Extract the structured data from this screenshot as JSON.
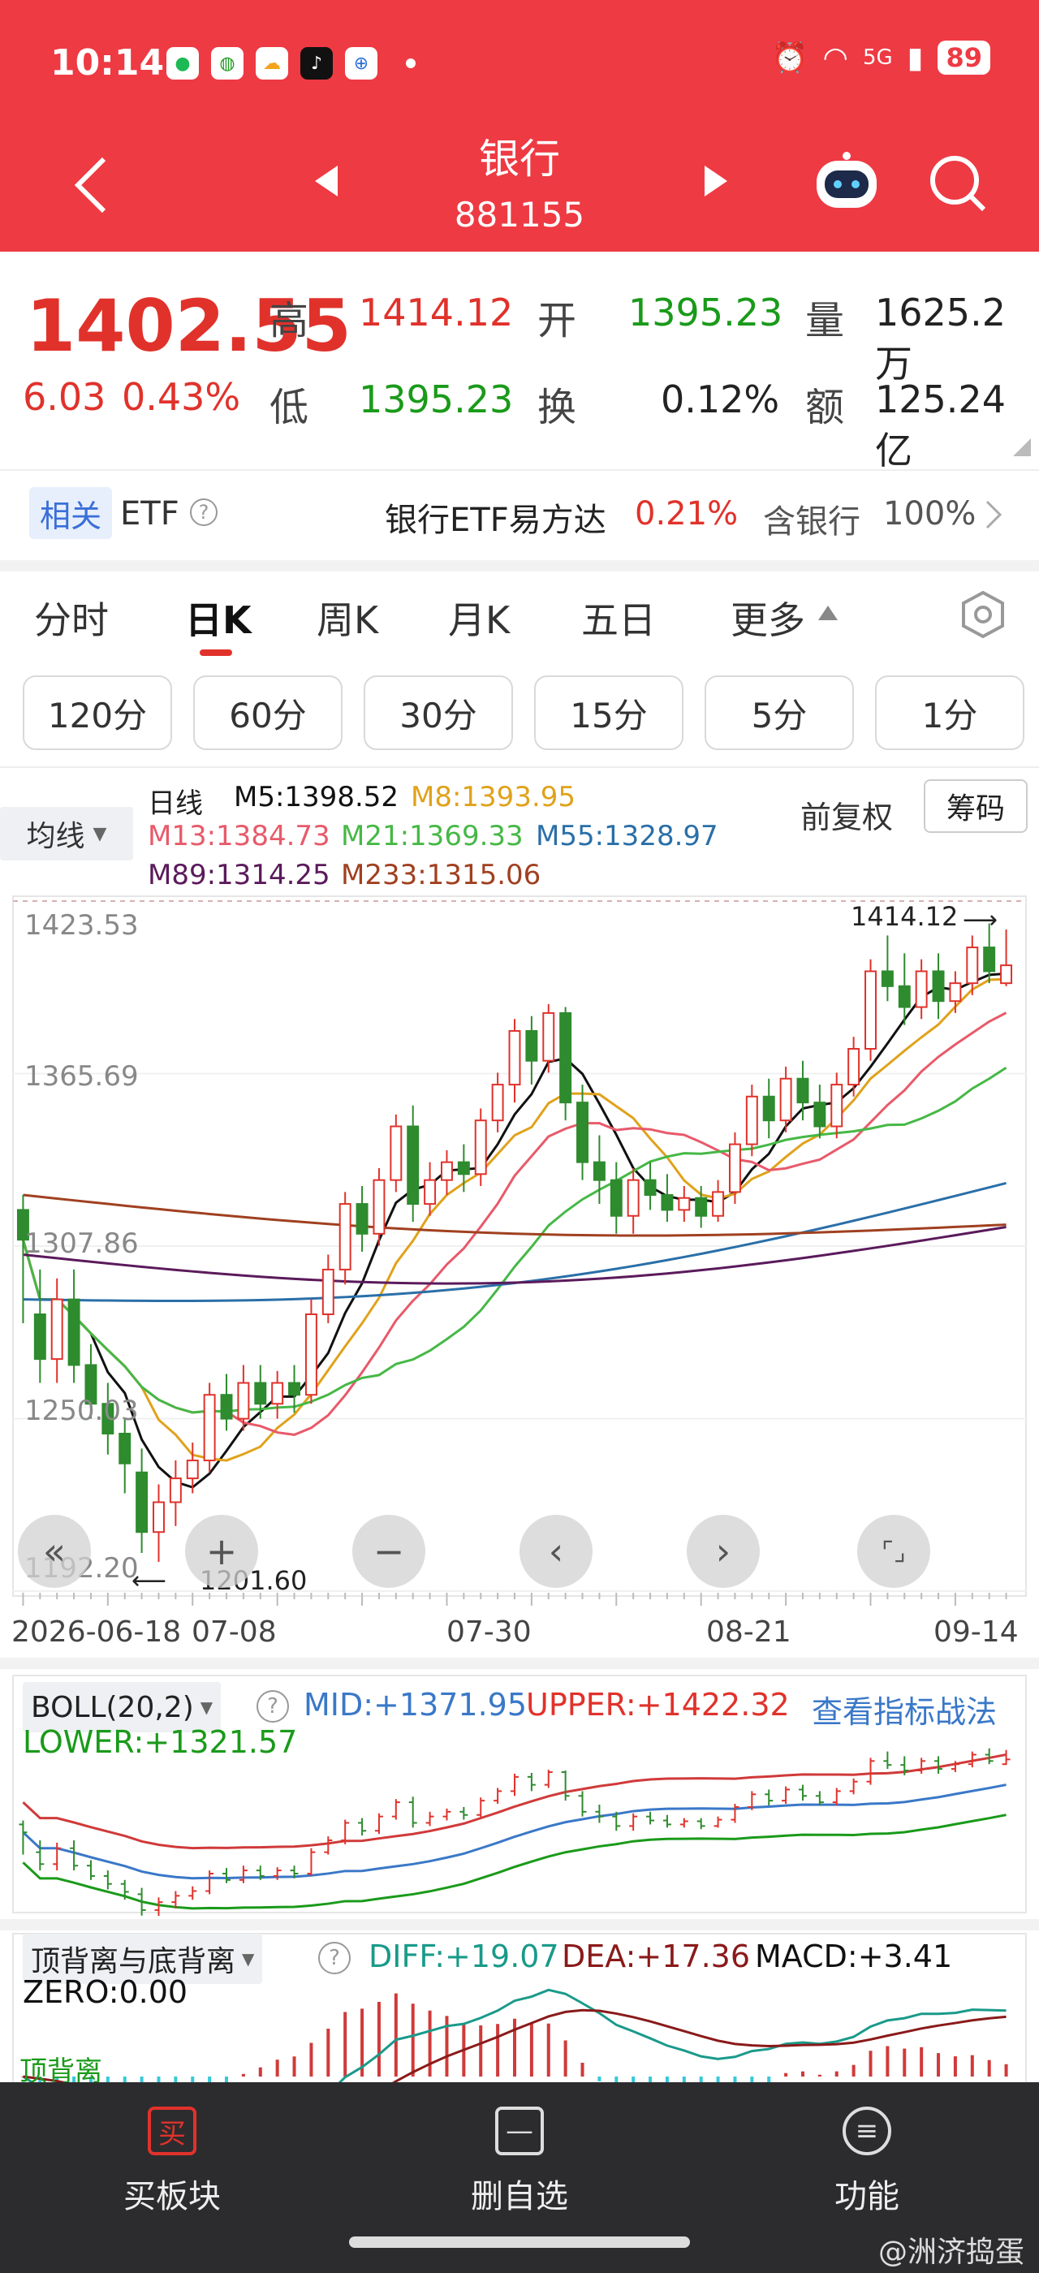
{
  "status_bar": {
    "time": "10:14",
    "signal": "5G",
    "battery": "89"
  },
  "header": {
    "title": "银行",
    "code": "881155"
  },
  "quote": {
    "price": "1402.55",
    "change": "6.03",
    "change_pct": "0.43%",
    "high_label": "高",
    "high": "1414.12",
    "open_label": "开",
    "open": "1395.23",
    "volume_label": "量",
    "volume": "1625.2万",
    "low_label": "低",
    "low": "1395.23",
    "turnover_label": "换",
    "turnover": "0.12%",
    "amount_label": "额",
    "amount": "125.24亿"
  },
  "etf": {
    "tag": "相关",
    "label": "ETF",
    "name": "银行ETF易方达",
    "pct": "0.21%",
    "hold": "含银行",
    "hold_pct": "100%"
  },
  "tabs": [
    "分时",
    "日K",
    "周K",
    "月K",
    "五日",
    "更多"
  ],
  "intervals": [
    "120分",
    "60分",
    "30分",
    "15分",
    "5分",
    "1分"
  ],
  "legend": {
    "selector": "均线",
    "line": "日线",
    "m5": "M5:1398.52",
    "m8": "M8:1393.95",
    "m13": "M13:1384.73",
    "m21": "M21:1369.33",
    "m55": "M55:1328.97",
    "m89": "M89:1314.25",
    "m233": "M233:1315.06",
    "adjust": "前复权",
    "chips": "筹码"
  },
  "colors": {
    "red": "#e0322b",
    "green": "#1a9a1a",
    "header": "#ee3a43",
    "m5": "#111111",
    "m8": "#e0a21b",
    "m13": "#e85a6a",
    "m21": "#46b846",
    "m55": "#2a6fa8",
    "m89": "#5b1a5b",
    "m233": "#a04020"
  },
  "price_labels": {
    "p1": "1423.53",
    "p2": "1365.69",
    "p3": "1307.86",
    "p4": "1250.03",
    "p5": "1192.20",
    "max": "1414.12",
    "min": "1201.60"
  },
  "chart_data": {
    "type": "candlestick",
    "y_ticks": [
      1423.53,
      1365.69,
      1307.86,
      1250.03,
      1192.2
    ],
    "ylim": [
      1192.2,
      1423.53
    ],
    "x_tick_labels": [
      "2026-06-18",
      "07-08",
      "07-30",
      "08-21",
      "09-14"
    ],
    "max_marker": 1414.12,
    "min_marker": 1201.6,
    "candles": [
      [
        1320,
        1310,
        1325,
        1282
      ],
      [
        1285,
        1270,
        1300,
        1262
      ],
      [
        1270,
        1290,
        1297,
        1262
      ],
      [
        1290,
        1268,
        1300,
        1262
      ],
      [
        1268,
        1255,
        1275,
        1250
      ],
      [
        1255,
        1245,
        1262,
        1238
      ],
      [
        1245,
        1235,
        1250,
        1225
      ],
      [
        1232,
        1212,
        1240,
        1205
      ],
      [
        1212,
        1222,
        1228,
        1202
      ],
      [
        1222,
        1230,
        1236,
        1214
      ],
      [
        1230,
        1236,
        1242,
        1225
      ],
      [
        1236,
        1258,
        1262,
        1232
      ],
      [
        1258,
        1250,
        1265,
        1246
      ],
      [
        1250,
        1262,
        1268,
        1246
      ],
      [
        1262,
        1255,
        1268,
        1250
      ],
      [
        1255,
        1262,
        1266,
        1250
      ],
      [
        1262,
        1258,
        1268,
        1252
      ],
      [
        1258,
        1285,
        1290,
        1255
      ],
      [
        1285,
        1300,
        1305,
        1282
      ],
      [
        1300,
        1322,
        1326,
        1295
      ],
      [
        1322,
        1312,
        1328,
        1306
      ],
      [
        1312,
        1330,
        1334,
        1308
      ],
      [
        1330,
        1348,
        1352,
        1326
      ],
      [
        1348,
        1322,
        1355,
        1316
      ],
      [
        1322,
        1330,
        1336,
        1318
      ],
      [
        1330,
        1336,
        1340,
        1325
      ],
      [
        1336,
        1332,
        1342,
        1326
      ],
      [
        1332,
        1350,
        1354,
        1328
      ],
      [
        1350,
        1362,
        1366,
        1346
      ],
      [
        1362,
        1380,
        1384,
        1356
      ],
      [
        1380,
        1370,
        1385,
        1362
      ],
      [
        1370,
        1386,
        1389,
        1366
      ],
      [
        1386,
        1356,
        1388,
        1350
      ],
      [
        1356,
        1336,
        1362,
        1330
      ],
      [
        1336,
        1330,
        1345,
        1322
      ],
      [
        1330,
        1318,
        1336,
        1312
      ],
      [
        1318,
        1330,
        1334,
        1312
      ],
      [
        1330,
        1325,
        1336,
        1320
      ],
      [
        1325,
        1320,
        1332,
        1316
      ],
      [
        1320,
        1324,
        1328,
        1316
      ],
      [
        1324,
        1318,
        1328,
        1314
      ],
      [
        1318,
        1326,
        1330,
        1316
      ],
      [
        1326,
        1342,
        1346,
        1322
      ],
      [
        1342,
        1358,
        1362,
        1338
      ],
      [
        1358,
        1350,
        1364,
        1344
      ],
      [
        1350,
        1364,
        1368,
        1346
      ],
      [
        1364,
        1356,
        1370,
        1350
      ],
      [
        1356,
        1348,
        1362,
        1344
      ],
      [
        1348,
        1362,
        1366,
        1344
      ],
      [
        1362,
        1374,
        1378,
        1358
      ],
      [
        1374,
        1400,
        1404,
        1370
      ],
      [
        1400,
        1395,
        1412,
        1390
      ],
      [
        1395,
        1388,
        1406,
        1382
      ],
      [
        1388,
        1400,
        1404,
        1384
      ],
      [
        1400,
        1390,
        1406,
        1384
      ],
      [
        1390,
        1396,
        1400,
        1386
      ],
      [
        1396,
        1408,
        1412,
        1392
      ],
      [
        1408,
        1400,
        1416,
        1396
      ],
      [
        1396,
        1402,
        1414,
        1395
      ]
    ],
    "ma_latest": {
      "M5": 1398.52,
      "M8": 1393.95,
      "M13": 1384.73,
      "M21": 1369.33,
      "M55": 1328.97,
      "M89": 1314.25,
      "M233": 1315.06
    }
  },
  "controls": [
    "«",
    "+",
    "−",
    "‹",
    "›",
    "⌜⌟"
  ],
  "boll": {
    "name": "BOLL(20,2)",
    "mid": "MID:+1371.95",
    "upper": "UPPER:+1422.32",
    "lower": "LOWER:+1321.57",
    "link": "查看指标战法"
  },
  "macd": {
    "name": "顶背离与底背离",
    "diff": "DIFF:+19.07",
    "dea": "DEA:+17.36",
    "macd": "MACD:+3.41",
    "zero": "ZERO:0.00",
    "tag": "顶背离"
  },
  "bottom_bar": {
    "buy": "买板块",
    "remove": "删自选",
    "func": "功能"
  },
  "watermark": "@洲济捣蛋"
}
